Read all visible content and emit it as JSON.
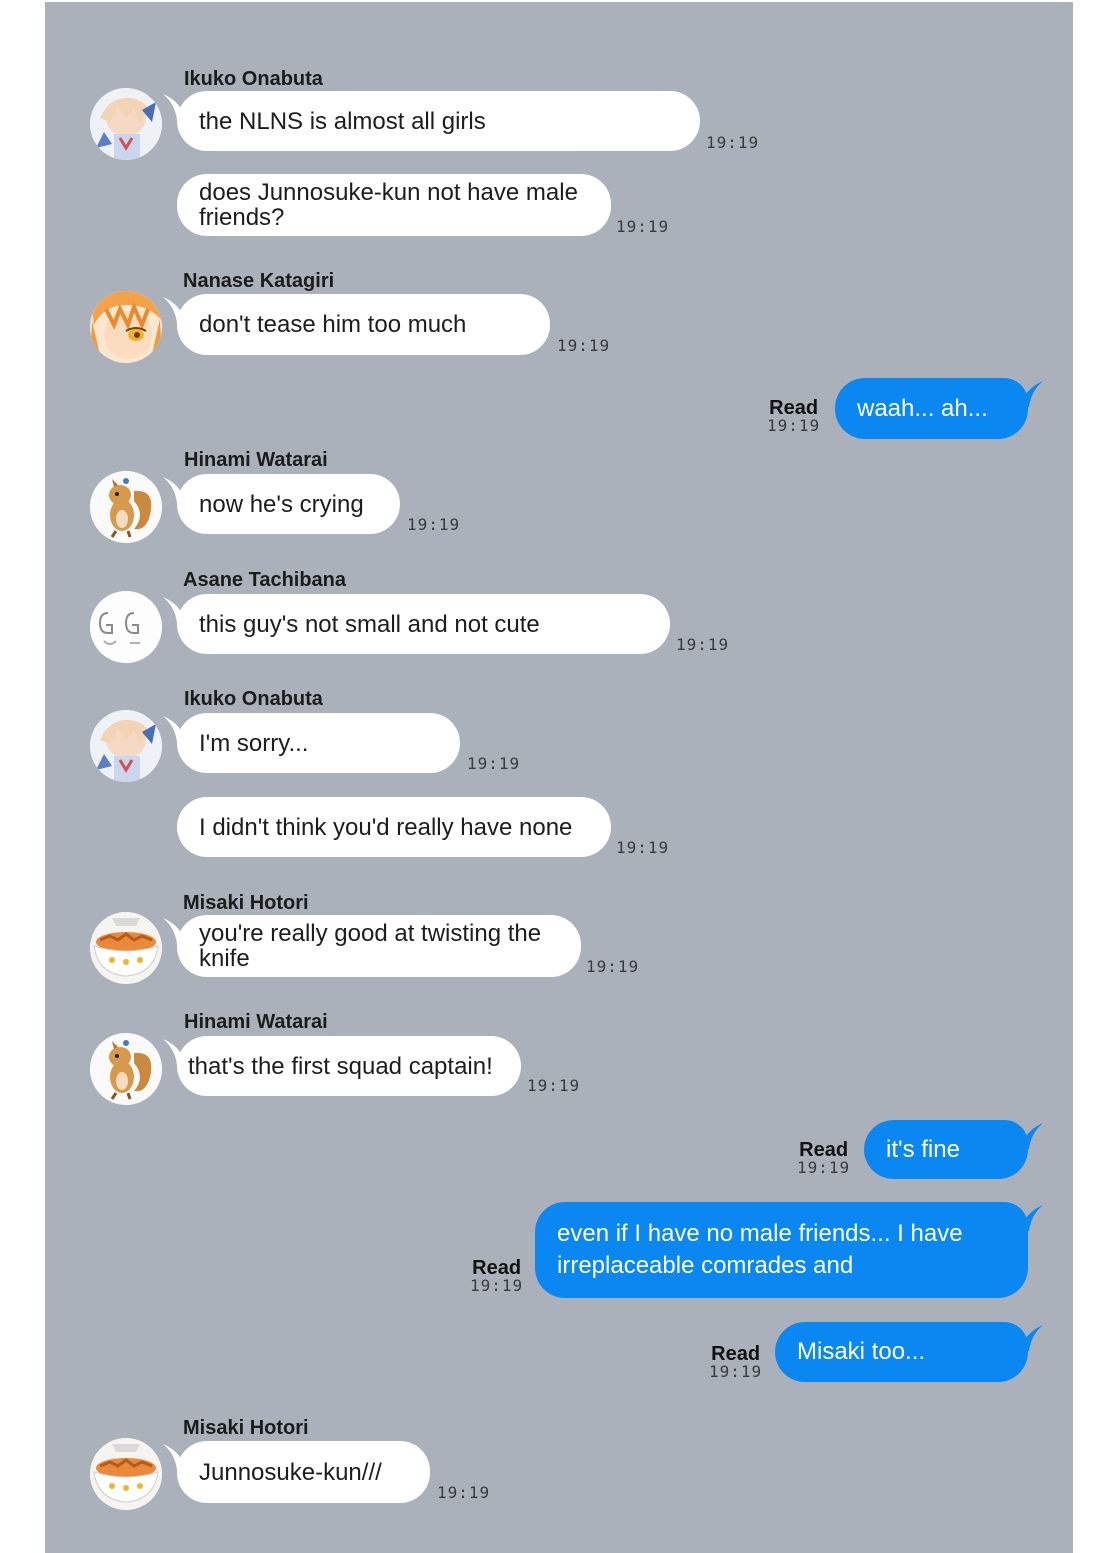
{
  "colors": {
    "background": "#abb1ba",
    "incoming_bubble": "#ffffff",
    "outgoing_bubble": "#0b87f2"
  },
  "messages": [
    {
      "sender": "Ikuko Onabuta",
      "avatar": "ikuko-avatar-icon",
      "text": "the NLNS is almost all girls",
      "time": "19:19"
    },
    {
      "text": "does Junnosuke-kun not have male friends?",
      "time": "19:19"
    },
    {
      "sender": "Nanase Katagiri",
      "avatar": "nanase-avatar-icon",
      "text": "don't tease him too much",
      "time": "19:19"
    },
    {
      "outgoing": true,
      "text": "waah... ah...",
      "status": "Read",
      "time": "19:19"
    },
    {
      "sender": "Hinami Watarai",
      "avatar": "squirrel-avatar-icon",
      "text": "now he's crying",
      "time": "19:19"
    },
    {
      "sender": "Asane Tachibana",
      "avatar": "asane-avatar-icon",
      "text": "this guy's not small and not cute",
      "time": "19:19"
    },
    {
      "sender": "Ikuko Onabuta",
      "avatar": "ikuko-avatar-icon",
      "text": "I'm sorry...",
      "time": "19:19"
    },
    {
      "text": "I didn't think you'd really have none",
      "time": "19:19"
    },
    {
      "sender": "Misaki Hotori",
      "avatar": "rice-bowl-avatar-icon",
      "text": "you're really good at twisting the knife",
      "time": "19:19"
    },
    {
      "sender": "Hinami Watarai",
      "avatar": "squirrel-avatar-icon",
      "text": "that's the first squad captain!",
      "time": "19:19"
    },
    {
      "outgoing": true,
      "text": "it's fine",
      "status": "Read",
      "time": "19:19"
    },
    {
      "outgoing": true,
      "text": "even if I have no male friends... I have irreplaceable comrades and",
      "status": "Read",
      "time": "19:19"
    },
    {
      "outgoing": true,
      "text": "Misaki too...",
      "status": "Read",
      "time": "19:19"
    },
    {
      "sender": "Misaki Hotori",
      "avatar": "rice-bowl-avatar-icon",
      "text": "Junnosuke-kun///",
      "time": "19:19"
    }
  ]
}
